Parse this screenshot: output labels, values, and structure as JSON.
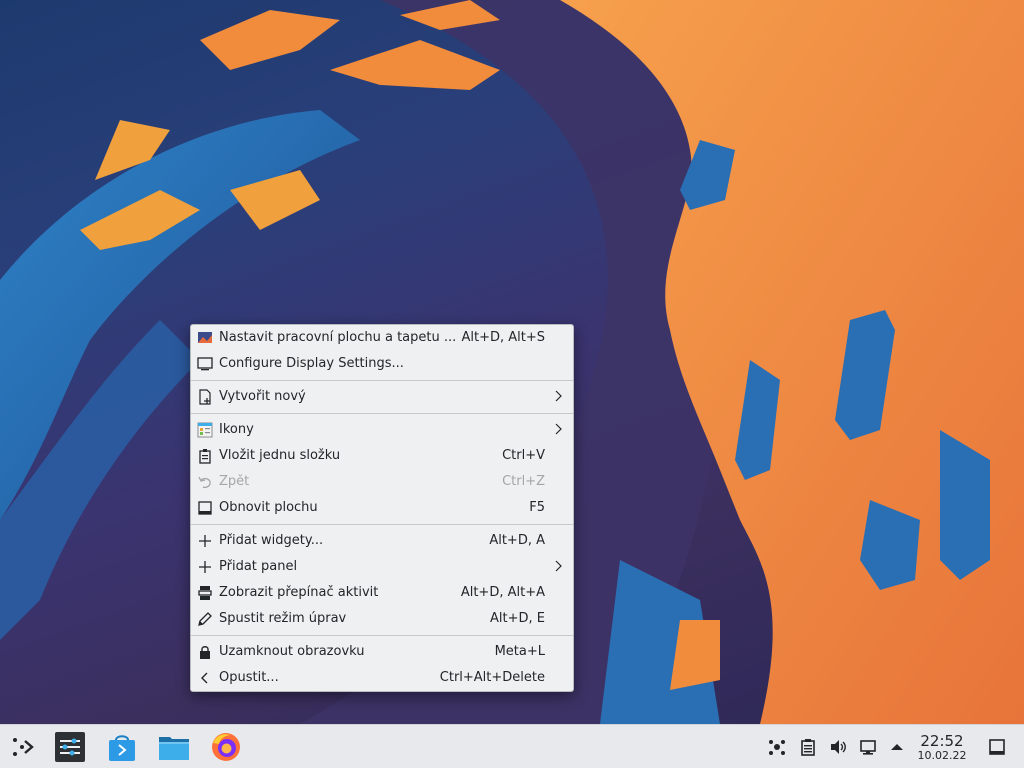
{
  "menu": {
    "groups": [
      [
        {
          "icon": "desktop-wallpaper-icon",
          "label": "Nastavit pracovní plochu a tapetu ...",
          "shortcut": "Alt+D, Alt+S",
          "submenu": false,
          "disabled": false
        },
        {
          "icon": "monitor-icon",
          "label": "Configure Display Settings...",
          "shortcut": "",
          "submenu": false,
          "disabled": false
        }
      ],
      [
        {
          "icon": "new-document-icon",
          "label": "Vytvořit nový",
          "shortcut": "",
          "submenu": true,
          "disabled": false
        }
      ],
      [
        {
          "icon": "icons-view-icon",
          "label": "Ikony",
          "shortcut": "",
          "submenu": true,
          "disabled": false
        },
        {
          "icon": "clipboard-paste-icon",
          "label": "Vložit jednu složku",
          "shortcut": "Ctrl+V",
          "submenu": false,
          "disabled": false
        },
        {
          "icon": "undo-icon",
          "label": "Zpět",
          "shortcut": "Ctrl+Z",
          "submenu": false,
          "disabled": true
        },
        {
          "icon": "refresh-desktop-icon",
          "label": "Obnovit plochu",
          "shortcut": "F5",
          "submenu": false,
          "disabled": false
        }
      ],
      [
        {
          "icon": "plus-icon",
          "label": "Přidat widgety...",
          "shortcut": "Alt+D, A",
          "submenu": false,
          "disabled": false
        },
        {
          "icon": "plus-icon",
          "label": "Přidat panel",
          "shortcut": "",
          "submenu": true,
          "disabled": false
        },
        {
          "icon": "activities-icon",
          "label": "Zobrazit přepínač aktivit",
          "shortcut": "Alt+D, Alt+A",
          "submenu": false,
          "disabled": false
        },
        {
          "icon": "edit-pencil-icon",
          "label": "Spustit režim úprav",
          "shortcut": "Alt+D, E",
          "submenu": false,
          "disabled": false
        }
      ],
      [
        {
          "icon": "lock-icon",
          "label": "Uzamknout obrazovku",
          "shortcut": "Meta+L",
          "submenu": false,
          "disabled": false
        },
        {
          "icon": "leave-chevron-icon",
          "label": "Opustit...",
          "shortcut": "Ctrl+Alt+Delete",
          "submenu": false,
          "disabled": false
        }
      ]
    ]
  },
  "taskbar": {
    "launchers": [
      {
        "name": "application-launcher-icon"
      },
      {
        "name": "system-settings-icon"
      },
      {
        "name": "discover-store-icon"
      },
      {
        "name": "file-manager-icon"
      },
      {
        "name": "firefox-icon"
      }
    ],
    "tray": [
      "network-share-icon",
      "clipboard-icon",
      "volume-icon",
      "network-icon",
      "tray-expand-icon"
    ],
    "clock": {
      "time": "22:52",
      "date": "10.02.22"
    }
  },
  "colors": {
    "menu_bg": "#eff0f1",
    "menu_text": "#232629",
    "disabled_text": "#a4a6a8",
    "taskbar_bg": "#e7e9ec",
    "wallpaper_orange": "#f08c3c",
    "wallpaper_blue": "#2a6fb4"
  }
}
